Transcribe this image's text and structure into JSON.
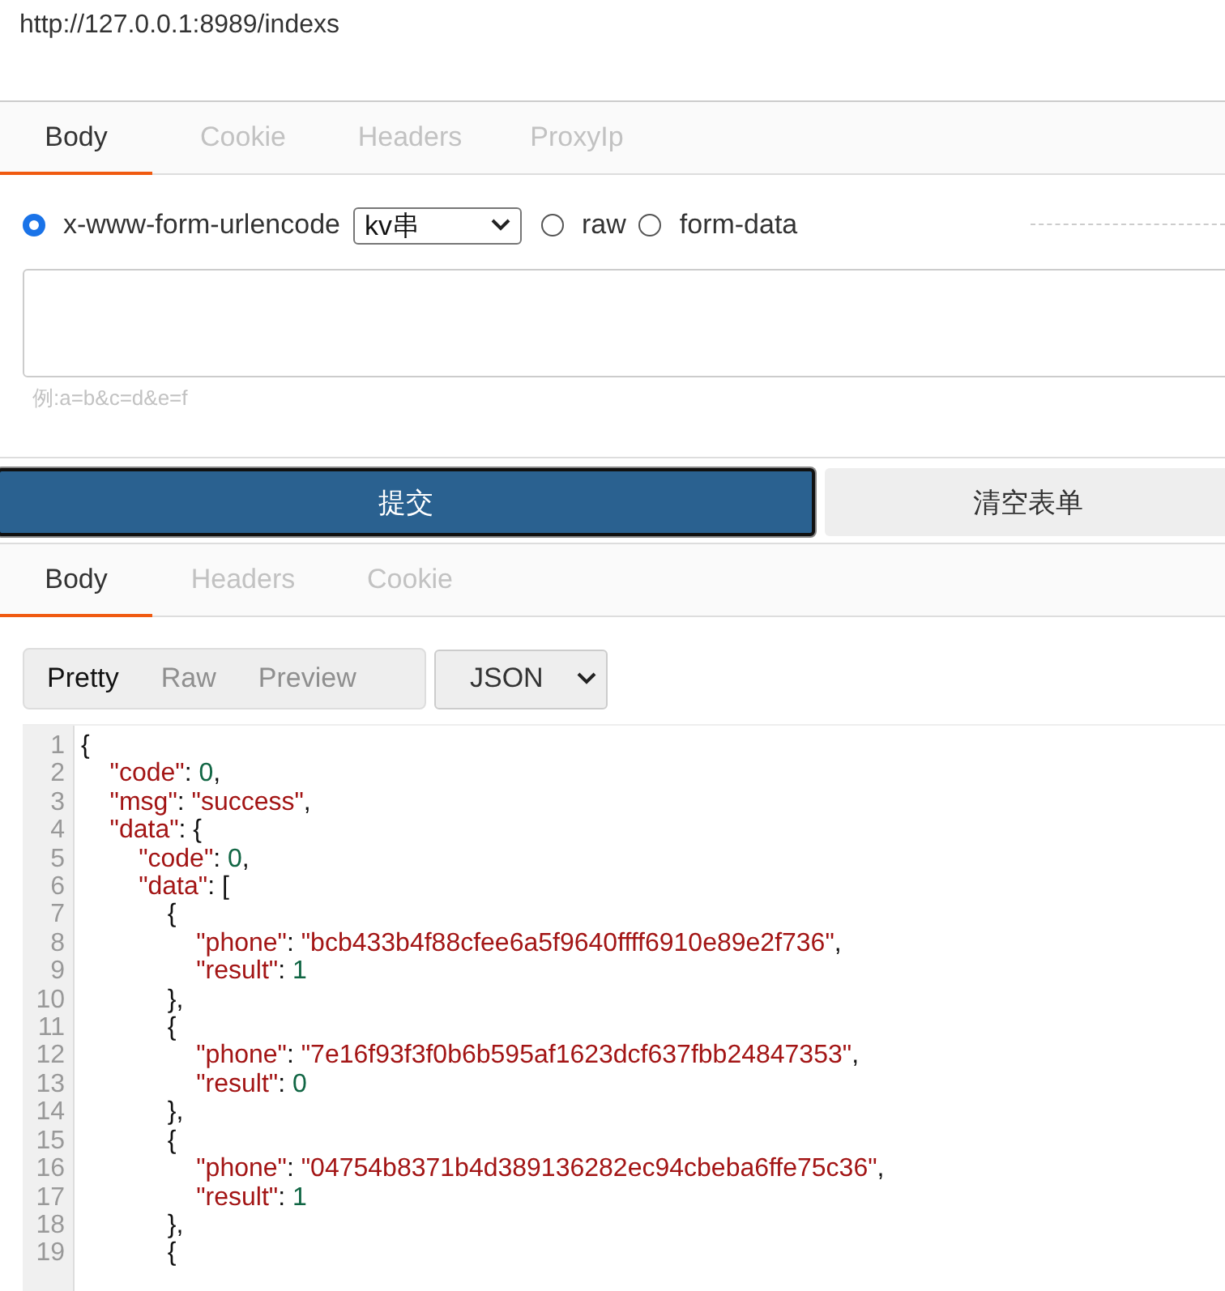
{
  "url": "http://127.0.0.1:8989/indexs",
  "request_tabs": [
    {
      "label": "Body",
      "selected": true
    },
    {
      "label": "Cookie",
      "selected": false
    },
    {
      "label": "Headers",
      "selected": false
    },
    {
      "label": "ProxyIp",
      "selected": false
    }
  ],
  "body_types": [
    {
      "label": "x-www-form-urlencode",
      "selected": true,
      "select_value": "kv串"
    },
    {
      "label": "raw",
      "selected": false
    },
    {
      "label": "form-data",
      "selected": false
    }
  ],
  "body_hint": "例:a=b&c=d&e=f",
  "buttons": [
    {
      "label": "提交",
      "kind": "primary"
    },
    {
      "label": "清空表单",
      "kind": "secondary"
    }
  ],
  "response_tabs": [
    {
      "label": "Body",
      "selected": true
    },
    {
      "label": "Headers",
      "selected": false
    },
    {
      "label": "Cookie",
      "selected": false
    }
  ],
  "view_modes": [
    {
      "label": "Pretty",
      "selected": true
    },
    {
      "label": "Raw",
      "selected": false
    },
    {
      "label": "Preview",
      "selected": false
    }
  ],
  "format_select": "JSON",
  "code_lines": [
    {
      "number": "1",
      "tokens": [
        {
          "kind": "punct",
          "text": "{"
        }
      ]
    },
    {
      "number": "2",
      "tokens": [
        {
          "kind": "key",
          "text": "    \"code\""
        },
        {
          "kind": "punct",
          "text": ": "
        },
        {
          "kind": "number",
          "text": "0"
        },
        {
          "kind": "punct",
          "text": ","
        }
      ]
    },
    {
      "number": "3",
      "tokens": [
        {
          "kind": "key",
          "text": "    \"msg\""
        },
        {
          "kind": "punct",
          "text": ": "
        },
        {
          "kind": "string",
          "text": "\"success\""
        },
        {
          "kind": "punct",
          "text": ","
        }
      ]
    },
    {
      "number": "4",
      "tokens": [
        {
          "kind": "key",
          "text": "    \"data\""
        },
        {
          "kind": "punct",
          "text": ": {"
        }
      ]
    },
    {
      "number": "5",
      "tokens": [
        {
          "kind": "key",
          "text": "        \"code\""
        },
        {
          "kind": "punct",
          "text": ": "
        },
        {
          "kind": "number",
          "text": "0"
        },
        {
          "kind": "punct",
          "text": ","
        }
      ]
    },
    {
      "number": "6",
      "tokens": [
        {
          "kind": "key",
          "text": "        \"data\""
        },
        {
          "kind": "punct",
          "text": ": ["
        }
      ]
    },
    {
      "number": "7",
      "tokens": [
        {
          "kind": "punct",
          "text": "            {"
        }
      ]
    },
    {
      "number": "8",
      "tokens": [
        {
          "kind": "key",
          "text": "                \"phone\""
        },
        {
          "kind": "punct",
          "text": ": "
        },
        {
          "kind": "string",
          "text": "\"bcb433b4f88cfee6a5f9640ffff6910e89e2f736\""
        },
        {
          "kind": "punct",
          "text": ","
        }
      ]
    },
    {
      "number": "9",
      "tokens": [
        {
          "kind": "key",
          "text": "                \"result\""
        },
        {
          "kind": "punct",
          "text": ": "
        },
        {
          "kind": "number",
          "text": "1"
        }
      ]
    },
    {
      "number": "10",
      "tokens": [
        {
          "kind": "punct",
          "text": "            },"
        }
      ]
    },
    {
      "number": "11",
      "tokens": [
        {
          "kind": "punct",
          "text": "            {"
        }
      ]
    },
    {
      "number": "12",
      "tokens": [
        {
          "kind": "key",
          "text": "                \"phone\""
        },
        {
          "kind": "punct",
          "text": ": "
        },
        {
          "kind": "string",
          "text": "\"7e16f93f3f0b6b595af1623dcf637fbb24847353\""
        },
        {
          "kind": "punct",
          "text": ","
        }
      ]
    },
    {
      "number": "13",
      "tokens": [
        {
          "kind": "key",
          "text": "                \"result\""
        },
        {
          "kind": "punct",
          "text": ": "
        },
        {
          "kind": "number",
          "text": "0"
        }
      ]
    },
    {
      "number": "14",
      "tokens": [
        {
          "kind": "punct",
          "text": "            },"
        }
      ]
    },
    {
      "number": "15",
      "tokens": [
        {
          "kind": "punct",
          "text": "            {"
        }
      ]
    },
    {
      "number": "16",
      "tokens": [
        {
          "kind": "key",
          "text": "                \"phone\""
        },
        {
          "kind": "punct",
          "text": ": "
        },
        {
          "kind": "string",
          "text": "\"04754b8371b4d389136282ec94cbeba6ffe75c36\""
        },
        {
          "kind": "punct",
          "text": ","
        }
      ]
    },
    {
      "number": "17",
      "tokens": [
        {
          "kind": "key",
          "text": "                \"result\""
        },
        {
          "kind": "punct",
          "text": ": "
        },
        {
          "kind": "number",
          "text": "1"
        }
      ]
    },
    {
      "number": "18",
      "tokens": [
        {
          "kind": "punct",
          "text": "            },"
        }
      ]
    },
    {
      "number": "19",
      "tokens": [
        {
          "kind": "punct",
          "text": "            {"
        }
      ]
    }
  ]
}
